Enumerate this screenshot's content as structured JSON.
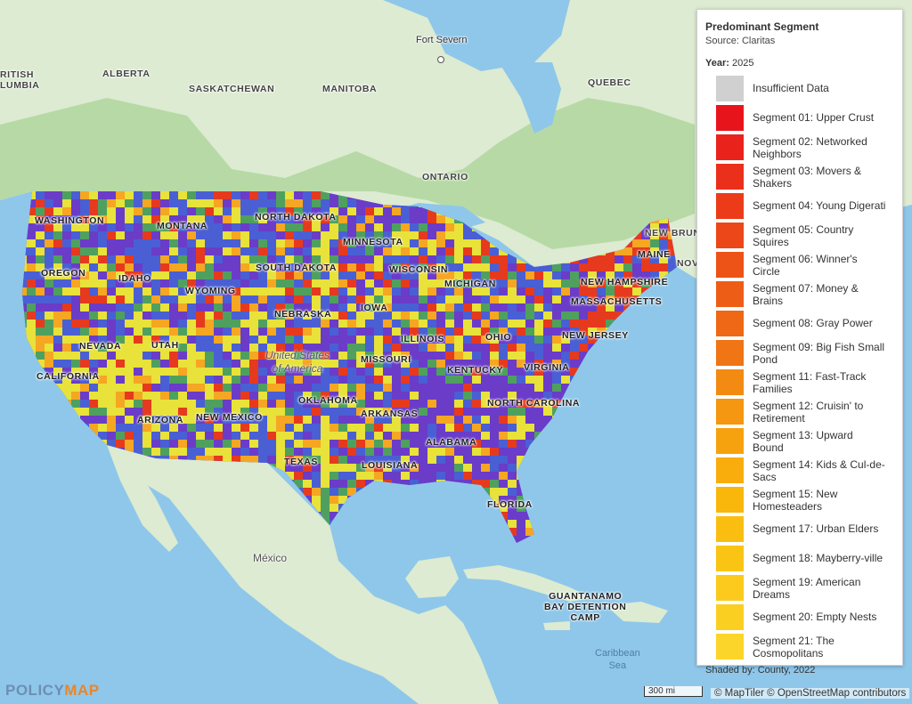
{
  "legend": {
    "title": "Predominant Segment",
    "source": "Source: Claritas",
    "year_label": "Year:",
    "year_value": "2025",
    "shaded_label": "Shaded by:",
    "shaded_value": "County, 2022",
    "items": [
      {
        "label": "Insufficient Data",
        "color": "#d0d0d0"
      },
      {
        "label": "Segment 01: Upper Crust",
        "color": "#e8141c"
      },
      {
        "label": "Segment 02: Networked Neighbors",
        "color": "#e9231b"
      },
      {
        "label": "Segment 03: Movers & Shakers",
        "color": "#ea301a"
      },
      {
        "label": "Segment 04: Young Digerati",
        "color": "#eb3b19"
      },
      {
        "label": "Segment 05: Country Squires",
        "color": "#ec4718"
      },
      {
        "label": "Segment 06: Winner's Circle",
        "color": "#ed5217"
      },
      {
        "label": "Segment 07: Money & Brains",
        "color": "#ee5d16"
      },
      {
        "label": "Segment 08: Gray Power",
        "color": "#ef6815"
      },
      {
        "label": "Segment 09: Big Fish Small Pond",
        "color": "#f07514"
      },
      {
        "label": "Segment 11: Fast-Track Families",
        "color": "#f38a12"
      },
      {
        "label": "Segment 12: Cruisin' to Retirement",
        "color": "#f59710"
      },
      {
        "label": "Segment 13: Upward Bound",
        "color": "#f6a20e"
      },
      {
        "label": "Segment 14: Kids & Cul-de-Sacs",
        "color": "#f8ad0d"
      },
      {
        "label": "Segment 15: New Homesteaders",
        "color": "#f9b70c"
      },
      {
        "label": "Segment 17: Urban Elders",
        "color": "#fabe10"
      },
      {
        "label": "Segment 18: Mayberry-ville",
        "color": "#fac415"
      },
      {
        "label": "Segment 19: American Dreams",
        "color": "#fbca1c"
      },
      {
        "label": "Segment 20: Empty Nests",
        "color": "#fbcf22"
      },
      {
        "label": "Segment 21: The Cosmopolitans",
        "color": "#fcd52a"
      }
    ]
  },
  "map_colors": {
    "ocean": "#8fc7ea",
    "land": "#dcebd1",
    "forest": "#b7d9a6",
    "us_blue": "#4a5fd3",
    "us_purple": "#6a3cc8",
    "us_green": "#4fa05f",
    "us_yellow": "#e8e23a",
    "us_orange": "#f5a623",
    "us_red": "#e53a1e"
  },
  "labels": {
    "british_columbia": "RITISH\nLUMBIA",
    "alberta": "ALBERTA",
    "saskatchewan": "SASKATCHEWAN",
    "manitoba": "MANITOBA",
    "fort_severn": "Fort Severn",
    "quebec": "QUEBEC",
    "ontario": "ONTARIO",
    "new_brunswick": "NEW BRUN",
    "nova": "NOV",
    "washington": "WASHINGTON",
    "montana": "MONTANA",
    "north_dakota": "NORTH DAKOTA",
    "minnesota": "MINNESOTA",
    "oregon": "OREGON",
    "idaho": "IDAHO",
    "wyoming": "WYOMING",
    "south_dakota": "SOUTH DAKOTA",
    "wisconsin": "WISCONSIN",
    "michigan": "MICHIGAN",
    "maine": "MAINE",
    "new_hampshire": "NEW HAMPSHIRE",
    "massachusetts": "MASSACHUSETTS",
    "nebraska": "NEBRASKA",
    "iowa": "IOWA",
    "nevada": "NEVADA",
    "utah": "UTAH",
    "illinois": "ILLINOIS",
    "ohio": "OHIO",
    "new_jersey": "NEW JERSEY",
    "united_states": "United States\nof America",
    "missouri": "MISSOURI",
    "kentucky": "KENTUCKY",
    "virginia": "VIRGINIA",
    "california": "CALIFORNIA",
    "oklahoma": "OKLAHOMA",
    "north_carolina": "NORTH CAROLINA",
    "arizona": "ARIZONA",
    "new_mexico": "NEW MEXICO",
    "arkansas": "ARKANSAS",
    "alabama": "ALABAMA",
    "texas": "TEXAS",
    "louisiana": "LOUISIANA",
    "florida": "FLORIDA",
    "mexico": "México",
    "guantanamo": "GUANTANAMO\nBAY DETENTION\nCAMP",
    "caribbean": "Caribbean\nSea"
  },
  "footer": {
    "logo_main": "POLICY",
    "logo_accent": "MAP",
    "scale": "300 mi",
    "attribution": "© MapTiler © OpenStreetMap contributors"
  }
}
